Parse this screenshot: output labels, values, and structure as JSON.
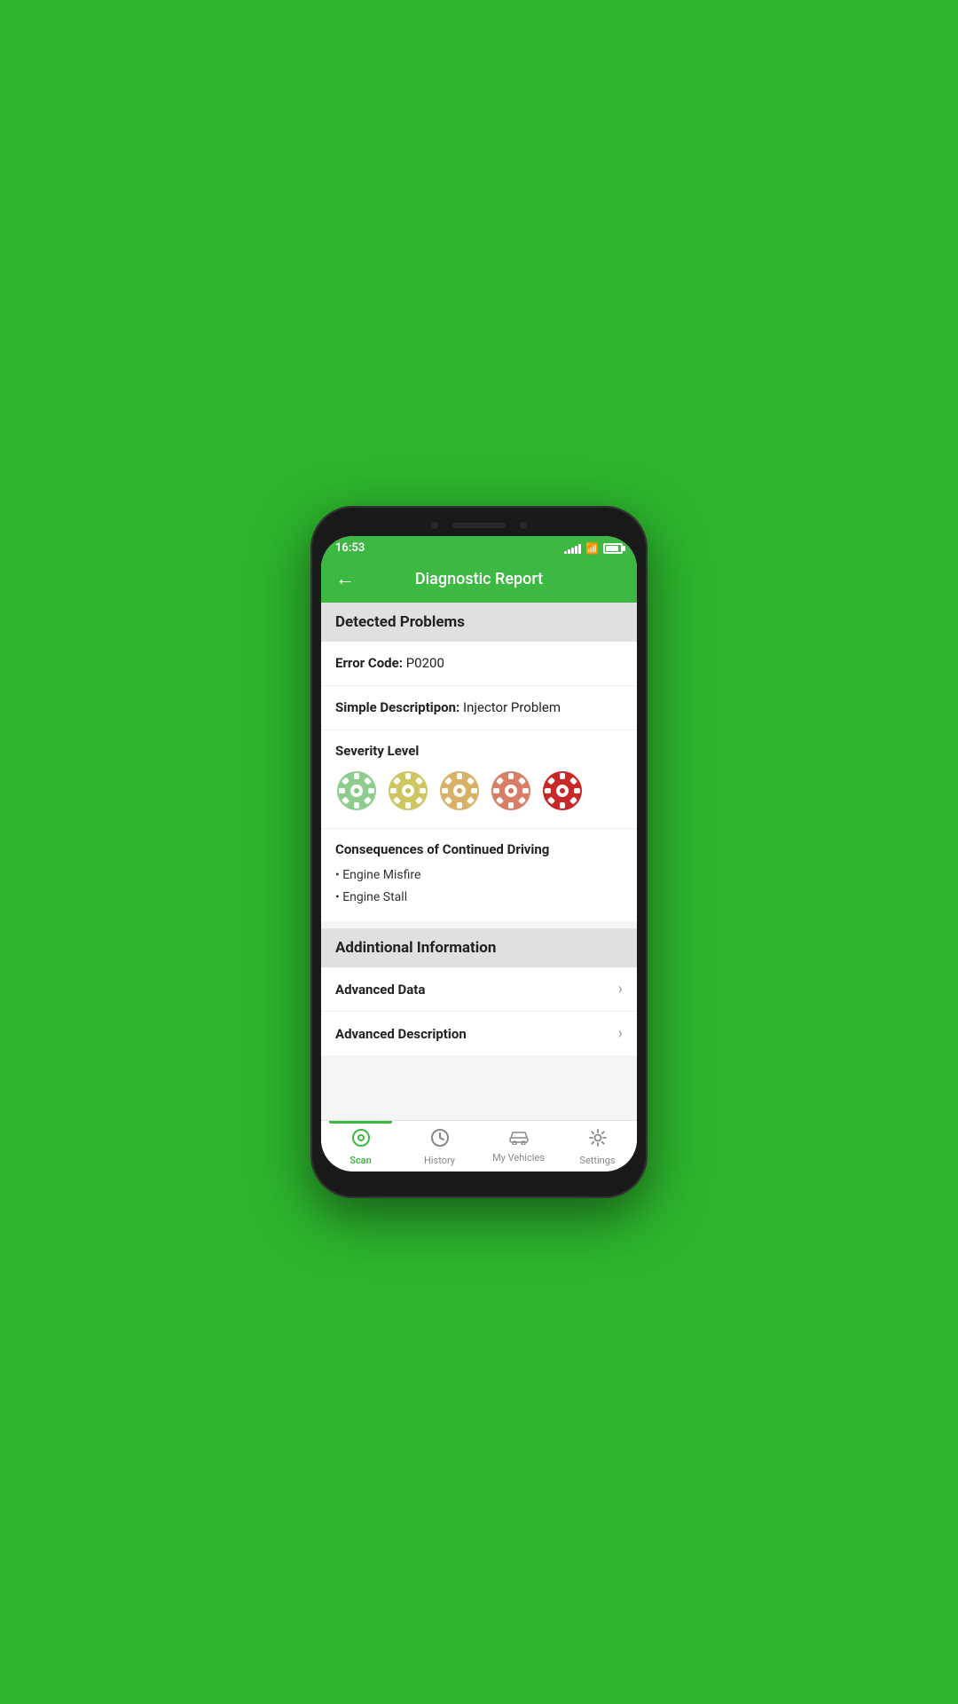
{
  "status_bar": {
    "time": "16:53"
  },
  "header": {
    "title": "Diagnostic Report",
    "back_label": "←"
  },
  "detected_problems": {
    "section_title": "Detected Problems",
    "error_code_label": "Error Code:",
    "error_code_value": "P0200",
    "simple_desc_label": "Simple Descriptipon:",
    "simple_desc_value": "Injector Problem",
    "severity_label": "Severity Level",
    "severity_levels": [
      {
        "color": "#82c882",
        "level": 1
      },
      {
        "color": "#c8c052",
        "level": 2
      },
      {
        "color": "#d4a855",
        "level": 3
      },
      {
        "color": "#d47055",
        "level": 4
      },
      {
        "color": "#c82828",
        "level": 5,
        "active": true
      }
    ],
    "consequences_title": "Consequences of Continued Driving",
    "consequences": [
      "Engine Misfire",
      "Engine Stall"
    ]
  },
  "additional_info": {
    "section_title": "Addintional Information",
    "items": [
      {
        "label": "Advanced Data"
      },
      {
        "label": "Advanced Description"
      }
    ]
  },
  "bottom_nav": {
    "items": [
      {
        "label": "Scan",
        "active": true
      },
      {
        "label": "History",
        "active": false
      },
      {
        "label": "My Vehicles",
        "active": false
      },
      {
        "label": "Settings",
        "active": false
      }
    ]
  }
}
